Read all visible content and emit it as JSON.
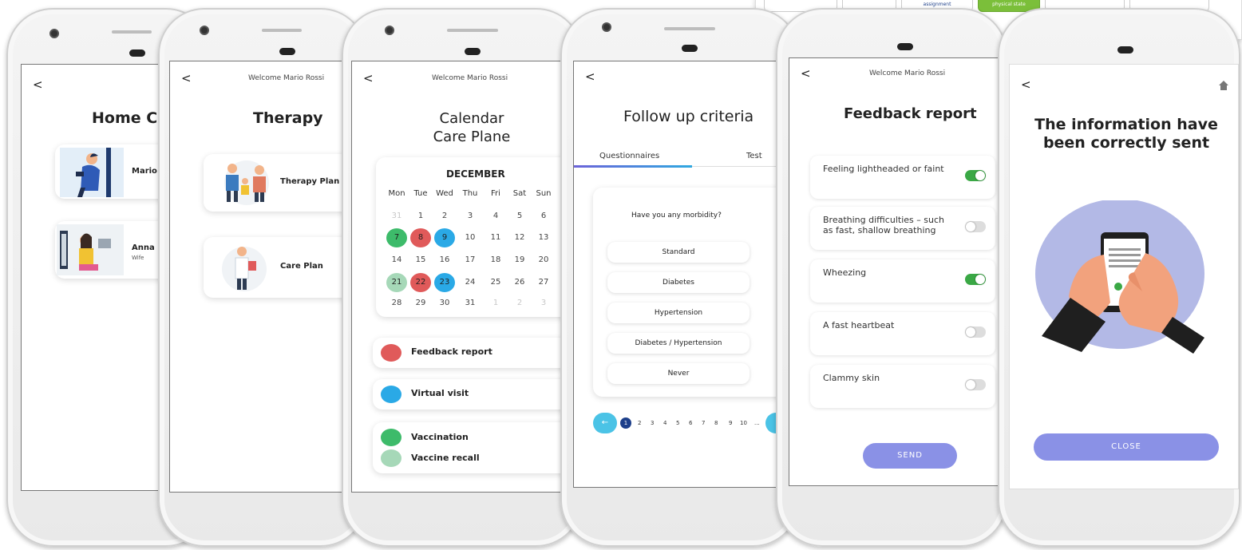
{
  "screens": {
    "home": {
      "back": "<",
      "title": "Home Ca",
      "patients": [
        {
          "name": "Mario I",
          "role": ""
        },
        {
          "name": "Anna B",
          "role": "Wife"
        }
      ]
    },
    "therapy": {
      "back": "<",
      "welcome": "Welcome Mario Rossi",
      "title": "Therapy",
      "items": [
        {
          "label": "Therapy Plan"
        },
        {
          "label": "Care Plan"
        }
      ]
    },
    "calendar": {
      "back": "<",
      "welcome": "Welcome Mario Rossi",
      "title_line1": "Calendar",
      "title_line2": "Care Plane",
      "month": "DECEMBER",
      "weekdays": [
        "Mon",
        "Tue",
        "Wed",
        "Thu",
        "Fri",
        "Sat",
        "Sun"
      ],
      "weeks": [
        [
          "31",
          "1",
          "2",
          "3",
          "4",
          "5",
          "6"
        ],
        [
          "7",
          "8",
          "9",
          "10",
          "11",
          "12",
          "13"
        ],
        [
          "14",
          "15",
          "16",
          "17",
          "18",
          "19",
          "20"
        ],
        [
          "21",
          "22",
          "23",
          "24",
          "25",
          "26",
          "27"
        ],
        [
          "28",
          "29",
          "30",
          "31",
          "1",
          "2",
          "3"
        ]
      ],
      "legend": [
        "Feedback report",
        "Virtual visit",
        "Vaccination",
        "Vaccine recall"
      ],
      "colors": {
        "feedback": "#e05a5a",
        "virtual": "#2aa9e6",
        "vaccination": "#3dbb6a",
        "recall": "#a6d8b8"
      }
    },
    "followup": {
      "back": "<",
      "title": "Follow up criteria",
      "tabs": [
        "Questionnaires",
        "Test"
      ],
      "question": "Have you any morbidity?",
      "options": [
        "Standard",
        "Diabetes",
        "Hypertension",
        "Diabetes / Hypertension",
        "Never"
      ],
      "pages": [
        "1",
        "2",
        "3",
        "4",
        "5",
        "6",
        "7",
        "8",
        "9",
        "10",
        "..."
      ],
      "prev_arrow": "←"
    },
    "feedback": {
      "back": "<",
      "welcome": "Welcome Mario Rossi",
      "title": "Feedback report",
      "symptoms": [
        {
          "text": "Feeling lightheaded or faint",
          "on": true
        },
        {
          "text": "Breathing difficulties – such as fast, shallow breathing",
          "on": false
        },
        {
          "text": "Wheezing",
          "on": true
        },
        {
          "text": "A fast heartbeat",
          "on": false
        },
        {
          "text": "Clammy skin",
          "on": false
        }
      ],
      "send_label": "SEND"
    },
    "sent": {
      "back": "<",
      "home_icon": "home-icon",
      "message": "The information have been correctly sent",
      "close_label": "CLOSE"
    }
  },
  "callout": {
    "chips": [
      {
        "label": "",
        "active": false
      },
      {
        "label": "",
        "active": false
      },
      {
        "label": "assignment",
        "active": false
      },
      {
        "label": "physical state",
        "active": true
      },
      {
        "label": "",
        "active": false
      },
      {
        "label": "",
        "active": false
      }
    ]
  },
  "colors": {
    "accent": "#8a91e6",
    "toggle_on": "#3aa845",
    "tab_underline": "#6c63d9"
  }
}
